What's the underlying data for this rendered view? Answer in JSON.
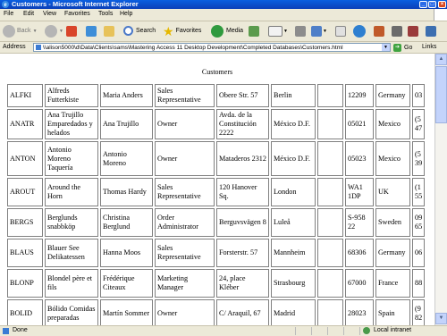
{
  "window": {
    "title": "Customers - Microsoft Internet Explorer",
    "buttons": {
      "minimize": "_",
      "maximize": "□",
      "close": "×"
    }
  },
  "menu": [
    "File",
    "Edit",
    "View",
    "Favorites",
    "Tools",
    "Help"
  ],
  "toolbar": {
    "back": "Back",
    "search": "Search",
    "favorites": "Favorites",
    "media": "Media"
  },
  "address": {
    "label": "Address",
    "value": "\\\\alison5000\\d\\Data\\Clients\\sams\\Mastering Access 11 Desktop Development\\Completed Databases\\Customers.html",
    "go": "Go",
    "links": "Links"
  },
  "page": {
    "heading": "Customers",
    "rows": [
      [
        "ALFKI",
        "Alfreds Futterkiste",
        "Maria Anders",
        "Sales Representative",
        "Obere Str. 57",
        "Berlin",
        "",
        "12209",
        "Germany",
        "03"
      ],
      [
        "ANATR",
        "Ana Trujillo Emparedados y helados",
        "Ana Trujillo",
        "Owner",
        "Avda. de la Constitución 2222",
        "México D.F.",
        "",
        "05021",
        "Mexico",
        "(5 47"
      ],
      [
        "ANTON",
        "Antonio Moreno Taquería",
        "Antonio Moreno",
        "Owner",
        "Mataderos 2312",
        "México D.F.",
        "",
        "05023",
        "Mexico",
        "(5 39"
      ],
      [
        "AROUT",
        "Around the Horn",
        "Thomas Hardy",
        "Sales Representative",
        "120 Hanover Sq.",
        "London",
        "",
        "WA1 1DP",
        "UK",
        "(1 55"
      ],
      [
        "BERGS",
        "Berglunds snabbköp",
        "Christina Berglund",
        "Order Administrator",
        "Berguvsvägen 8",
        "Luleå",
        "",
        "S-958 22",
        "Sweden",
        "09 65"
      ],
      [
        "BLAUS",
        "Blauer See Delikatessen",
        "Hanna Moos",
        "Sales Representative",
        "Forsterstr. 57",
        "Mannheim",
        "",
        "68306",
        "Germany",
        "06"
      ],
      [
        "BLONP",
        "Blondel père et fils",
        "Frédérique Citeaux",
        "Marketing Manager",
        "24, place Kléber",
        "Strasbourg",
        "",
        "67000",
        "France",
        "88"
      ],
      [
        "BOLID",
        "Bólido Comidas preparadas",
        "Martín Sommer",
        "Owner",
        "C/ Araquil, 67",
        "Madrid",
        "",
        "28023",
        "Spain",
        "(9 82"
      ],
      [
        "",
        "",
        "",
        "",
        "",
        "",
        "",
        "",
        "",
        ""
      ]
    ]
  },
  "status": {
    "left": "Done",
    "zone": "Local intranet"
  }
}
